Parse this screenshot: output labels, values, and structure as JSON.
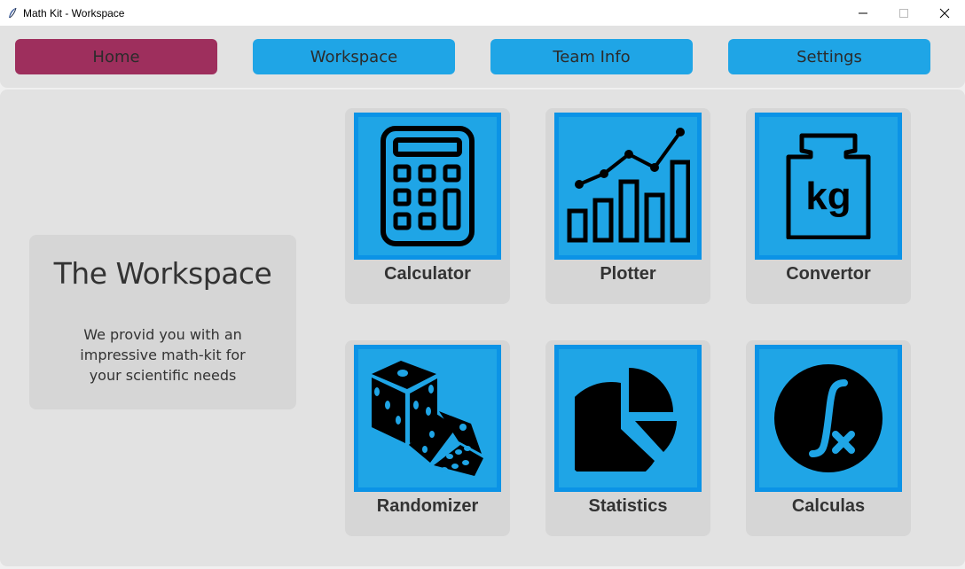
{
  "window": {
    "title": "Math Kit - Workspace",
    "app_icon": "feather-icon",
    "controls": [
      "minimize-icon",
      "maximize-icon",
      "close-icon"
    ]
  },
  "nav": {
    "active": "Home",
    "active_color": "#9e2f5d",
    "button_color": "#1fa5e6",
    "items": [
      {
        "label": "Home"
      },
      {
        "label": "Workspace"
      },
      {
        "label": "Team Info"
      },
      {
        "label": "Settings"
      }
    ]
  },
  "intro": {
    "heading": "The Workspace",
    "description": "We provid you with an impressive math-kit for your scientific needs"
  },
  "tools": [
    {
      "label": "Calculator",
      "icon": "calculator-icon"
    },
    {
      "label": "Plotter",
      "icon": "bar-line-chart-icon"
    },
    {
      "label": "Convertor",
      "icon": "kg-weight-icon"
    },
    {
      "label": "Randomizer",
      "icon": "dice-icon"
    },
    {
      "label": "Statistics",
      "icon": "pie-chart-icon"
    },
    {
      "label": "Calculas",
      "icon": "integral-icon"
    }
  ],
  "colors": {
    "tile_fill": "#1fa5e6",
    "tile_border": "#0b93e6",
    "card_bg": "#d6d6d6",
    "panel_bg": "#e2e2e2"
  }
}
